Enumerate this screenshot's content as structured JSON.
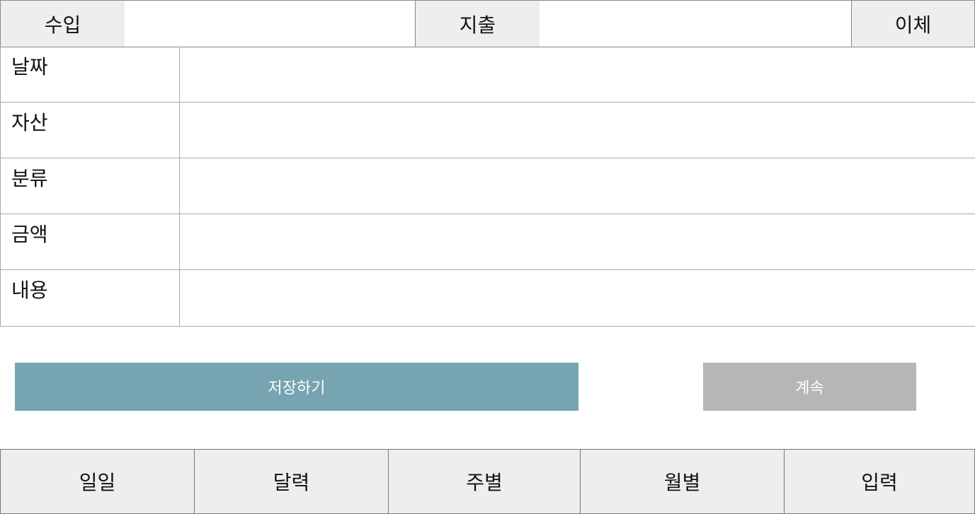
{
  "type_tabs": {
    "income": "수입",
    "expense": "지출",
    "transfer": "이체"
  },
  "form": {
    "rows": [
      {
        "label": "날짜",
        "value": ""
      },
      {
        "label": "자산",
        "value": ""
      },
      {
        "label": "분류",
        "value": ""
      },
      {
        "label": "금액",
        "value": ""
      },
      {
        "label": "내용",
        "value": ""
      }
    ]
  },
  "actions": {
    "save_label": "저장하기",
    "continue_label": "계속"
  },
  "bottom_nav": {
    "items": [
      {
        "label": "일일"
      },
      {
        "label": "달력"
      },
      {
        "label": "주별"
      },
      {
        "label": "월별"
      },
      {
        "label": "입력"
      }
    ]
  },
  "colors": {
    "save_button": "#76a4b0",
    "continue_button": "#b6b6b6",
    "tab_background": "#eeeeee"
  }
}
